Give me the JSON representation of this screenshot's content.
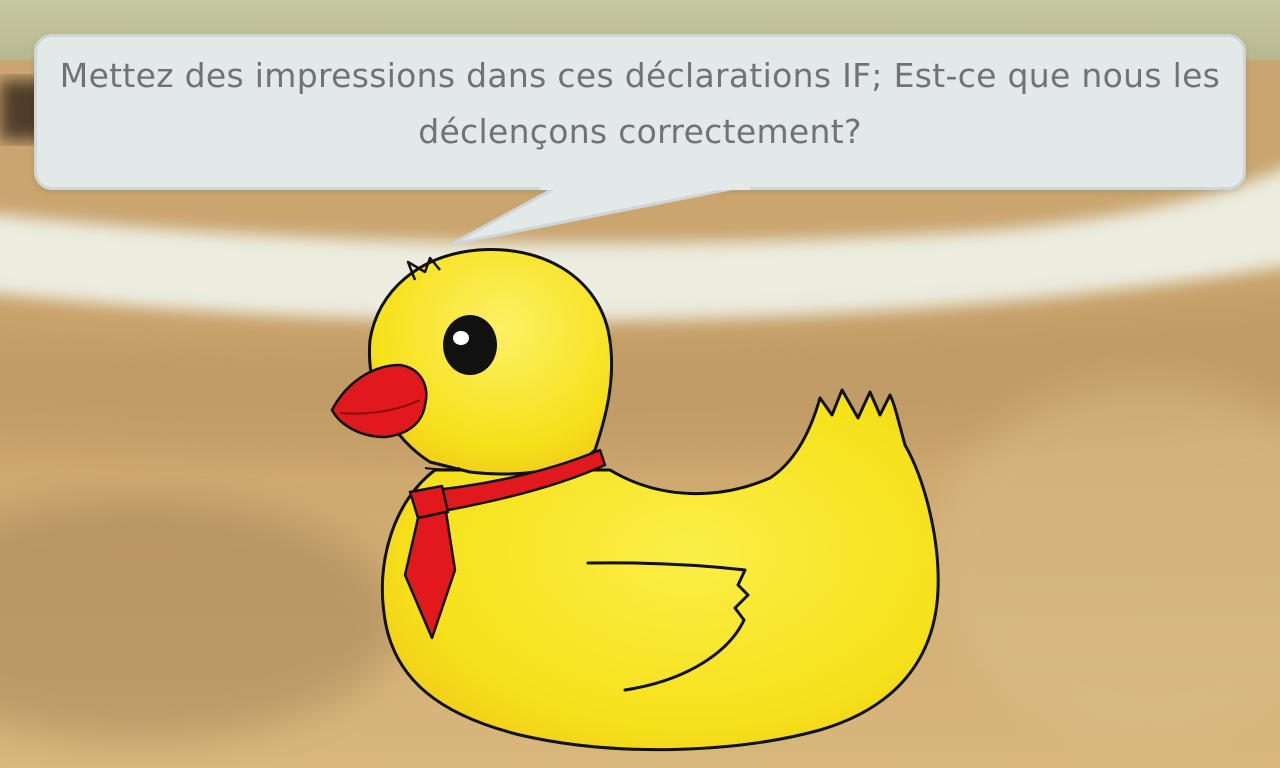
{
  "dialog": {
    "speaker": "rubber-duck",
    "line_1": "Mettez des impressions dans ces déclarations IF; Est-ce que nous les",
    "line_2": "déclençons correctement?"
  },
  "colors": {
    "duck_body": "#f7e41c",
    "duck_shadow": "#f0c51a",
    "beak": "#e2191c",
    "tie": "#e2191c",
    "bubble_fill": "#e3e9e8",
    "bubble_text": "#6f7373"
  }
}
